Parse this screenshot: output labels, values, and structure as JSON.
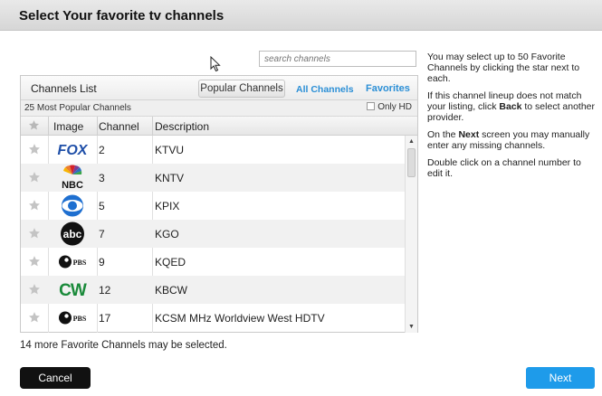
{
  "header": {
    "title": "Select Your favorite tv channels"
  },
  "search": {
    "placeholder": "search channels"
  },
  "panel": {
    "label": "Channels List",
    "tabs": {
      "popular": "Popular Channels",
      "all": "All Channels",
      "favorites": "Favorites"
    },
    "count_label": "25 Most Popular Channels",
    "only_hd_label": "Only HD",
    "columns": {
      "image": "Image",
      "channel": "Channel",
      "description": "Description"
    },
    "rows": [
      {
        "channel": "2",
        "description": "KTVU",
        "logo": "fox-logo"
      },
      {
        "channel": "3",
        "description": "KNTV",
        "logo": "nbc-logo"
      },
      {
        "channel": "5",
        "description": "KPIX",
        "logo": "cbs-logo"
      },
      {
        "channel": "7",
        "description": "KGO",
        "logo": "abc-logo"
      },
      {
        "channel": "9",
        "description": "KQED",
        "logo": "pbs-logo"
      },
      {
        "channel": "12",
        "description": "KBCW",
        "logo": "cw-logo"
      },
      {
        "channel": "17",
        "description": "KCSM MHz Worldview West HDTV",
        "logo": "pbs-logo"
      }
    ],
    "logo_text": {
      "fox": "FOX",
      "nbc": "NBC",
      "abc": "abc",
      "pbs": "PBS",
      "cw": "CW"
    }
  },
  "footer": {
    "remaining": "14 more Favorite Channels may be selected.",
    "cancel_label": "Cancel",
    "next_label": "Next"
  },
  "help": {
    "p1": "You may select up to 50 Favorite Channels by clicking the star next to each.",
    "p2_a": "If this channel lineup does not match your listing, click ",
    "p2_b": "Back",
    "p2_c": " to select another provider.",
    "p3_a": "On the ",
    "p3_b": "Next",
    "p3_c": " screen you may manually enter any missing channels.",
    "p4": "Double click on a channel number to edit it."
  },
  "colors": {
    "accent": "#2b8fd6",
    "next_button": "#1e9bea",
    "cancel_button": "#111111",
    "star": "#c4c4c4"
  }
}
